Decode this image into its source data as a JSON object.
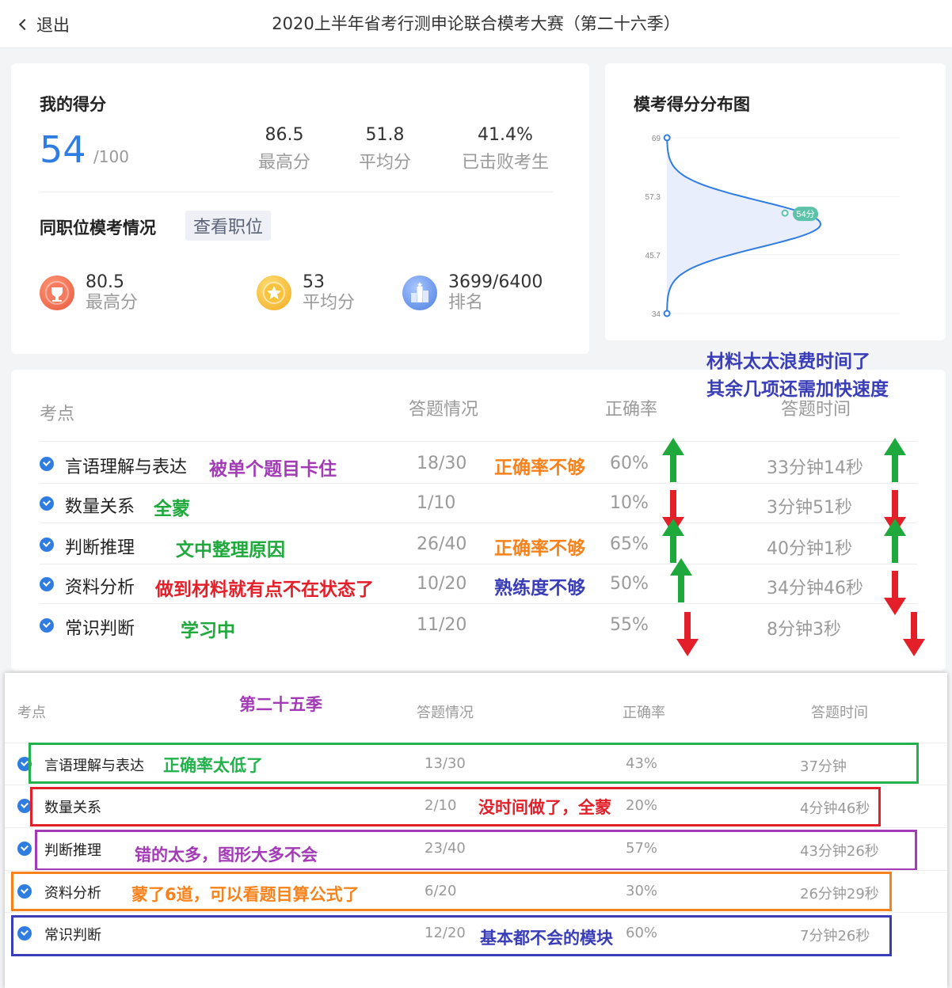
{
  "header": {
    "back_label": "退出",
    "title": "2020上半年省考行测申论联合模考大赛（第二十六季）"
  },
  "score": {
    "heading": "我的得分",
    "value": "54",
    "max": "/100",
    "stats": [
      {
        "value": "86.5",
        "label": "最高分"
      },
      {
        "value": "51.8",
        "label": "平均分"
      },
      {
        "value": "41.4%",
        "label": "已击败考生"
      }
    ]
  },
  "same_position": {
    "heading": "同职位模考情况",
    "view_button": "查看职位",
    "stats": [
      {
        "icon": "trophy-medal-icon",
        "value": "80.5",
        "label": "最高分",
        "color": "#f26b4f"
      },
      {
        "icon": "star-medal-icon",
        "value": "53",
        "label": "平均分",
        "color": "#f5b731"
      },
      {
        "icon": "ranking-podium-icon",
        "value": "3699/6400",
        "label": "排名",
        "color": "#5d8fe8"
      }
    ]
  },
  "chart_data": {
    "type": "area",
    "title": "模考得分分布图",
    "ytick_labels": [
      "69",
      "57.3",
      "45.7",
      "34"
    ],
    "ylim": [
      34,
      69
    ],
    "marker": {
      "score": 54,
      "label": "54分"
    },
    "curve": "bell curve oriented horizontally, peak near score 51.8"
  },
  "table1": {
    "headers": [
      "考点",
      "答题情况",
      "正确率",
      "答题时间"
    ],
    "rows": [
      {
        "name": "言语理解与表达",
        "answered": "18/30",
        "accuracy": "60%",
        "time": "33分钟14秒",
        "note": "被单个题目卡住",
        "note_color": "#a23bb5",
        "acc_note": "正确率不够",
        "acc_arrow": "up",
        "time_arrow": "up"
      },
      {
        "name": "数量关系",
        "answered": "1/10",
        "accuracy": "10%",
        "time": "3分钟51秒",
        "note": "全蒙",
        "note_color": "#1fa83b",
        "acc_note": "",
        "acc_arrow": "down",
        "time_arrow": "down"
      },
      {
        "name": "判断推理",
        "answered": "26/40",
        "accuracy": "65%",
        "time": "40分钟1秒",
        "note": "文中整理原因",
        "note_color": "#1fa83b",
        "acc_note": "正确率不够",
        "acc_arrow": "up",
        "time_arrow": "up"
      },
      {
        "name": "资料分析",
        "answered": "10/20",
        "accuracy": "50%",
        "time": "34分钟46秒",
        "note": "做到材料就有点不在状态了",
        "note_color": "#e3202a",
        "acc_note": "熟练度不够",
        "acc_arrow": "up",
        "time_arrow": "down"
      },
      {
        "name": "常识判断",
        "answered": "11/20",
        "accuracy": "55%",
        "time": "8分钟3秒",
        "note": "学习中",
        "note_color": "#1fa83b",
        "acc_note": "",
        "acc_arrow": "down",
        "time_arrow": "down"
      }
    ],
    "corner_note_1": "材料太太浪费时间了",
    "corner_note_2": "其余几项还需加快速度"
  },
  "table2": {
    "season_note": "第二十五季",
    "headers": [
      "考点",
      "答题情况",
      "正确率",
      "答题时间"
    ],
    "rows": [
      {
        "name": "言语理解与表达",
        "answered": "13/30",
        "accuracy": "43%",
        "time": "37分钟",
        "note": "正确率太低了",
        "color": "#22b14c"
      },
      {
        "name": "数量关系",
        "answered": "2/10",
        "accuracy": "20%",
        "time": "4分钟46秒",
        "note": "没时间做了，全蒙",
        "color": "#e3202a"
      },
      {
        "name": "判断推理",
        "answered": "23/40",
        "accuracy": "57%",
        "time": "43分钟26秒",
        "note": "错的太多，图形大多不会",
        "color": "#a23bb5"
      },
      {
        "name": "资料分析",
        "answered": "6/20",
        "accuracy": "30%",
        "time": "26分钟29秒",
        "note": "蒙了6道，可以看题目算公式了",
        "color": "#f7821b"
      },
      {
        "name": "常识判断",
        "answered": "12/20",
        "accuracy": "60%",
        "time": "7分钟26秒",
        "note": "基本都不会的模块",
        "color": "#3a3db8"
      }
    ]
  }
}
